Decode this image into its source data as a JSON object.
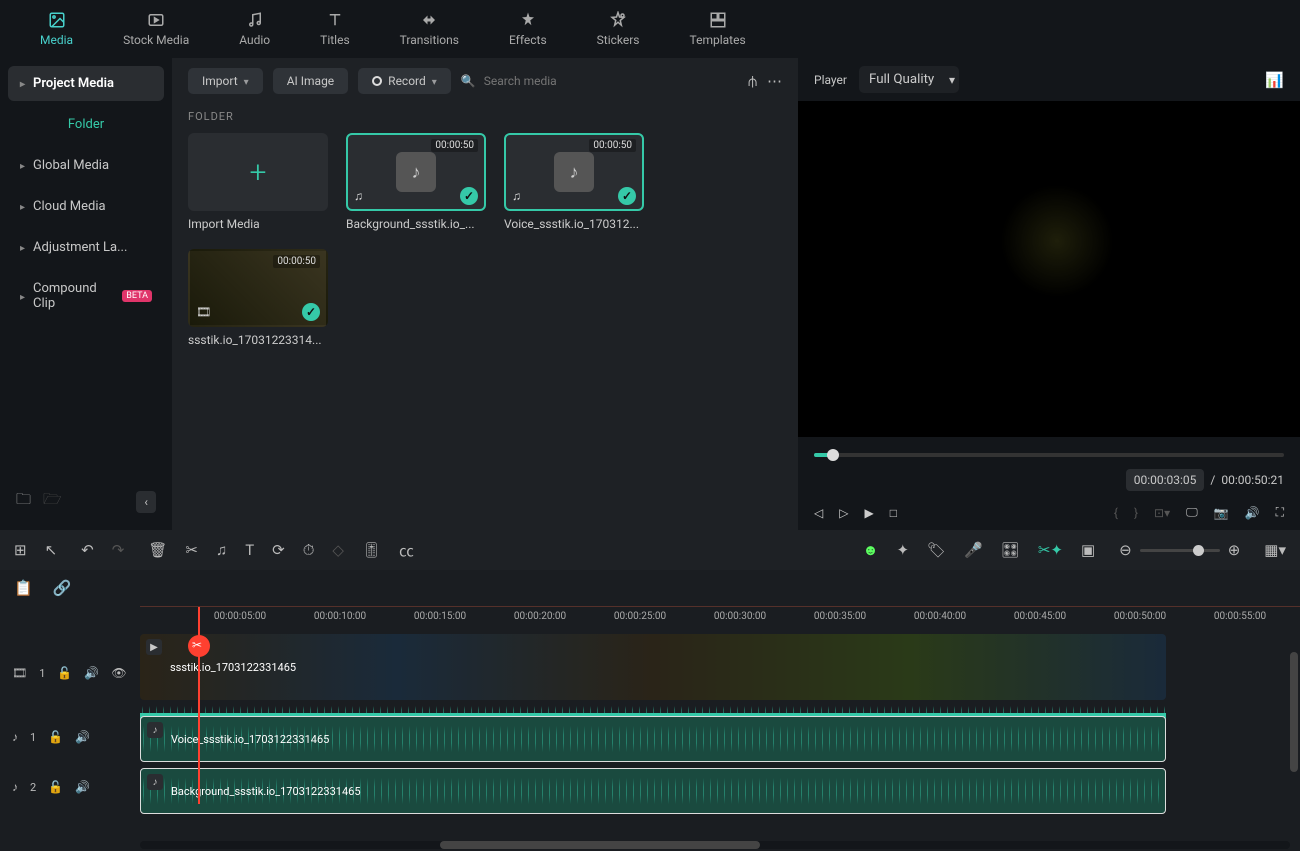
{
  "tabs": {
    "media": "Media",
    "stock": "Stock Media",
    "audio": "Audio",
    "titles": "Titles",
    "transitions": "Transitions",
    "effects": "Effects",
    "stickers": "Stickers",
    "templates": "Templates"
  },
  "sidebar": {
    "project_media": "Project Media",
    "folder": "Folder",
    "global_media": "Global Media",
    "cloud_media": "Cloud Media",
    "adjustment": "Adjustment La...",
    "compound": "Compound Clip",
    "compound_badge": "BETA"
  },
  "media_toolbar": {
    "import": "Import",
    "ai_image": "AI Image",
    "record": "Record",
    "search_placeholder": "Search media"
  },
  "folder_label": "FOLDER",
  "media": {
    "import": "Import Media",
    "item1_dur": "00:00:50",
    "item1_name": "Background_ssstik.io_...",
    "item2_dur": "00:00:50",
    "item2_name": "Voice_ssstik.io_170312...",
    "item3_dur": "00:00:50",
    "item3_name": "ssstik.io_17031223314..."
  },
  "player": {
    "label": "Player",
    "quality": "Full Quality",
    "current": "00:00:03:05",
    "sep": "/",
    "total": "00:00:50:21"
  },
  "ruler": {
    "t5": "00:00:05:00",
    "t10": "00:00:10:00",
    "t15": "00:00:15:00",
    "t20": "00:00:20:00",
    "t25": "00:00:25:00",
    "t30": "00:00:30:00",
    "t35": "00:00:35:00",
    "t40": "00:00:40:00",
    "t45": "00:00:45:00",
    "t50": "00:00:50:00",
    "t55": "00:00:55:00"
  },
  "tracks": {
    "video1": "1",
    "audio1": "1",
    "audio2": "2",
    "clip_video": "ssstik.io_1703122331465",
    "clip_voice": "Voice_ssstik.io_1703122331465",
    "clip_bg": "Background_ssstik.io_1703122331465"
  }
}
